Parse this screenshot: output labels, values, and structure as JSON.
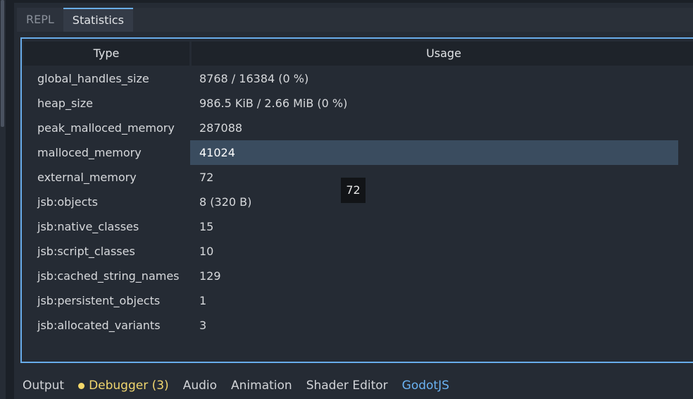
{
  "tabs": [
    "REPL",
    "Statistics"
  ],
  "table": {
    "headers": [
      "Type",
      "Usage"
    ],
    "rows": [
      {
        "type": "global_handles_size",
        "usage": "8768 / 16384 (0 %)"
      },
      {
        "type": "heap_size",
        "usage": "986.5 KiB / 2.66 MiB (0 %)"
      },
      {
        "type": "peak_malloced_memory",
        "usage": "287088"
      },
      {
        "type": "malloced_memory",
        "usage": "41024"
      },
      {
        "type": "external_memory",
        "usage": "72"
      },
      {
        "type": "jsb:objects",
        "usage": "8 (320 B)"
      },
      {
        "type": "jsb:native_classes",
        "usage": "15"
      },
      {
        "type": "jsb:script_classes",
        "usage": "10"
      },
      {
        "type": "jsb:cached_string_names",
        "usage": "129"
      },
      {
        "type": "jsb:persistent_objects",
        "usage": "1"
      },
      {
        "type": "jsb:allocated_variants",
        "usage": "3"
      }
    ]
  },
  "tooltip": "72",
  "bottom_tabs": {
    "output": "Output",
    "debugger": "Debugger (3)",
    "audio": "Audio",
    "animation": "Animation",
    "shader_editor": "Shader Editor",
    "godotjs": "GodotJS"
  },
  "colors": {
    "accent": "#68acea",
    "debugger_warning": "#f0d66e",
    "selection": "#3a4c5f"
  }
}
